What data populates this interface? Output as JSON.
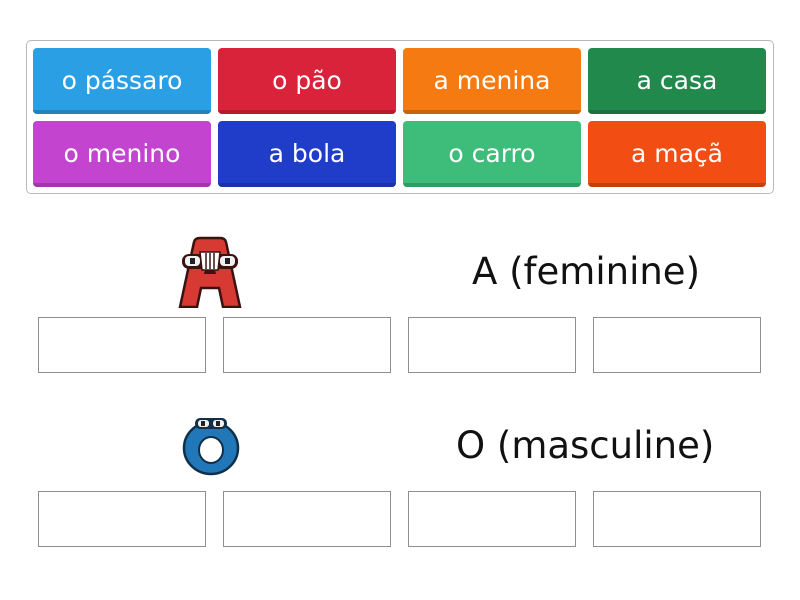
{
  "word_bank": {
    "tiles": [
      {
        "label": "o pássaro",
        "color": "#2a9fe3"
      },
      {
        "label": "o pão",
        "color": "#d8233a"
      },
      {
        "label": "a menina",
        "color": "#f57a12"
      },
      {
        "label": "a casa",
        "color": "#21894b"
      },
      {
        "label": "o menino",
        "color": "#c345cf"
      },
      {
        "label": "a bola",
        "color": "#1f3dc8"
      },
      {
        "label": "o carro",
        "color": "#3dbd79"
      },
      {
        "label": "a maçã",
        "color": "#f24e14"
      }
    ]
  },
  "groups": [
    {
      "title": "A (feminine)",
      "icon": "letter-a-character-icon",
      "icon_color": "#d63a33",
      "slots_filled": 0
    },
    {
      "title": "O (masculine)",
      "icon": "letter-o-character-icon",
      "icon_color": "#2277b8",
      "slots_filled": 0
    }
  ]
}
